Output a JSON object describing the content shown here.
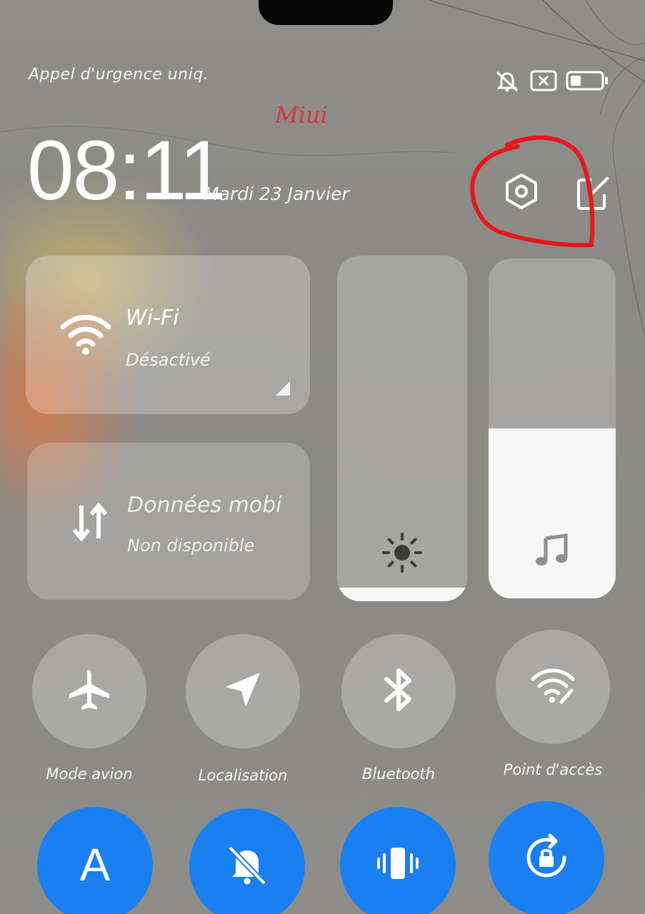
{
  "status_bar": {
    "carrier_text": "Appel d'urgence uniq.",
    "icons": [
      "mute-icon",
      "no-sim-icon",
      "battery-icon"
    ]
  },
  "watermark": "Miui",
  "header": {
    "time": "08:11",
    "date": "Mardi 23 Janvier",
    "settings_icon": "gear-icon",
    "edit_icon": "edit-icon"
  },
  "tiles": {
    "wifi": {
      "title": "Wi-Fi",
      "status": "Désactivé",
      "icon": "wifi-icon"
    },
    "mobile_data": {
      "title": "Données mobi",
      "status": "Non disponible",
      "icon": "data-arrows-icon"
    }
  },
  "sliders": {
    "brightness": {
      "icon": "sun-icon",
      "level": 0.04
    },
    "volume": {
      "icon": "music-note-icon",
      "level": 0.5
    }
  },
  "toggles": [
    {
      "label": "Mode avion",
      "icon": "airplane-icon"
    },
    {
      "label": "Localisation",
      "icon": "location-arrow-icon"
    },
    {
      "label": "Bluetooth",
      "icon": "bluetooth-icon"
    },
    {
      "label": "Point d'accès",
      "icon": "hotspot-icon"
    }
  ],
  "bottom_toggles": [
    {
      "text": "A",
      "icon": "auto-brightness-icon"
    },
    {
      "icon": "silent-bell-icon"
    },
    {
      "icon": "vibrate-icon"
    },
    {
      "icon": "rotation-lock-icon"
    }
  ],
  "colors": {
    "accent_blue": "#1a7ff0",
    "annotation_red": "#e81818",
    "watermark_red": "#e0323e"
  }
}
